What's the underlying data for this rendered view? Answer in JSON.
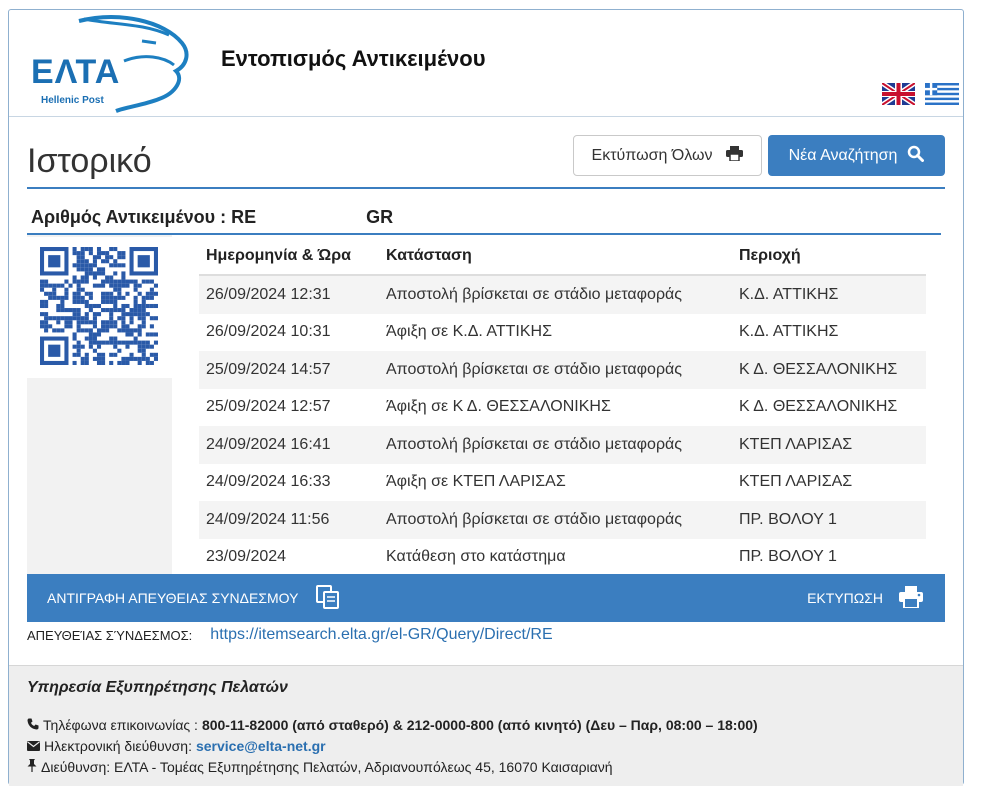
{
  "header": {
    "logo_text": "ΕΛΤΑ",
    "logo_subtext": "Hellenic Post",
    "title": "Εντοπισμός Αντικειμένου"
  },
  "history": {
    "title": "Ιστορικό",
    "print_all_label": "Εκτύπωση Όλων",
    "new_search_label": "Νέα Αναζήτηση",
    "item_number_label": "Αριθμός Αντικειμένου : RE",
    "item_number_suffix": "GR"
  },
  "table": {
    "headers": [
      "Ημερομηνία & Ώρα",
      "Κατάσταση",
      "Περιοχή"
    ],
    "rows": [
      {
        "datetime": "26/09/2024 12:31",
        "status": "Αποστολή βρίσκεται σε στάδιο μεταφοράς",
        "area": "Κ.Δ. ΑΤΤΙΚΗΣ"
      },
      {
        "datetime": "26/09/2024 10:31",
        "status": "Άφιξη σε Κ.Δ. ΑΤΤΙΚΗΣ",
        "area": "Κ.Δ. ΑΤΤΙΚΗΣ"
      },
      {
        "datetime": "25/09/2024 14:57",
        "status": "Αποστολή βρίσκεται σε στάδιο μεταφοράς",
        "area": "Κ Δ. ΘΕΣΣΑΛΟΝΙΚΗΣ"
      },
      {
        "datetime": "25/09/2024 12:57",
        "status": "Άφιξη σε Κ Δ. ΘΕΣΣΑΛΟΝΙΚΗΣ",
        "area": "Κ Δ. ΘΕΣΣΑΛΟΝΙΚΗΣ"
      },
      {
        "datetime": "24/09/2024 16:41",
        "status": "Αποστολή βρίσκεται σε στάδιο μεταφοράς",
        "area": "ΚΤΕΠ ΛΑΡΙΣΑΣ"
      },
      {
        "datetime": "24/09/2024 16:33",
        "status": "Άφιξη σε ΚΤΕΠ ΛΑΡΙΣΑΣ",
        "area": "ΚΤΕΠ ΛΑΡΙΣΑΣ"
      },
      {
        "datetime": "24/09/2024 11:56",
        "status": "Αποστολή βρίσκεται σε στάδιο μεταφοράς",
        "area": "ΠΡ. ΒΟΛΟΥ 1"
      },
      {
        "datetime": "23/09/2024",
        "status": "Κατάθεση στο κατάστημα",
        "area": "ΠΡ. ΒΟΛΟΥ 1"
      }
    ]
  },
  "actions": {
    "copy_link_label": "ΑΝΤΙΓΡΑΦΗ ΑΠΕΥΘΕΙΑΣ ΣΥΝΔΕΣΜΟΥ",
    "print_label": "ΕΚΤΥΠΩΣΗ"
  },
  "direct_link": {
    "label": "ΑΠΕΥΘΕΊΑΣ ΣΎΝΔΕΣΜΟΣ:",
    "url": "https://itemsearch.elta.gr/el-GR/Query/Direct/RE"
  },
  "footer": {
    "title": "Υπηρεσία Εξυπηρέτησης Πελατών",
    "phone_label": "Τηλέφωνα επικοινωνίας :",
    "phone_value": "800-11-82000 (από σταθερό) & 212-0000-800 (από κινητό) (Δευ – Παρ, 08:00 – 18:00)",
    "email_label": "Ηλεκτρονική διεύθυνση:",
    "email_value": "service@elta-net.gr",
    "address": "Διεύθυνση: ΕΛΤΑ - Τομέας Εξυπηρέτησης Πελατών, Αδριανουπόλεως 45, 16070 Καισαριανή"
  },
  "colors": {
    "primary": "#3b7ec0",
    "link": "#2a6fb0",
    "footer_bg": "#eeeeee"
  }
}
